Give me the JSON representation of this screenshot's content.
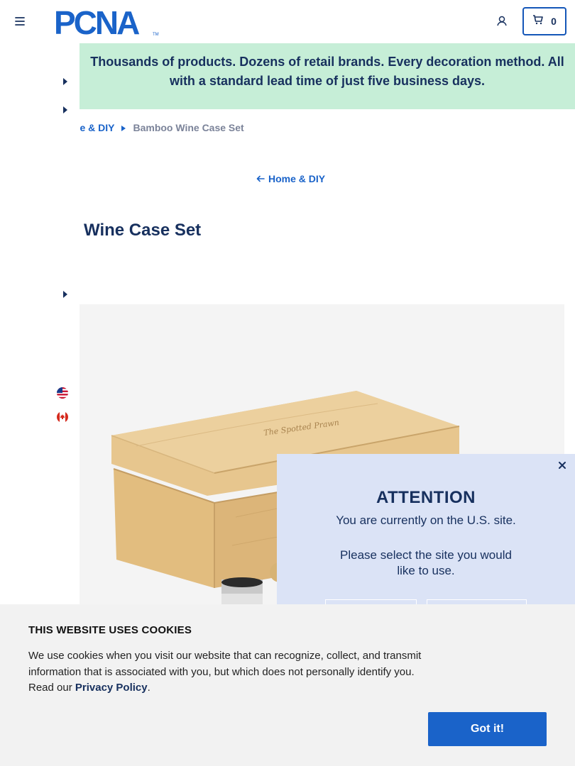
{
  "header": {
    "logo_text": "PCNA",
    "cart_count": "0"
  },
  "banner": {
    "text": "Thousands of products. Dozens of retail brands. Every decoration method. All with a standard lead time of just five business days."
  },
  "breadcrumb": {
    "parent": "me & DIY",
    "current": "Bamboo Wine Case Set"
  },
  "back_link": "Home & DIY",
  "product": {
    "title": "Wine Case Set",
    "brand_engraving": "The Spotted Prawn"
  },
  "modal": {
    "title": "ATTENTION",
    "line1": "You are currently on the U.S. site.",
    "line2": "Please select the site you would like to use."
  },
  "cookie": {
    "title": "THIS WEBSITE USES COOKIES",
    "text_before": "We use cookies when you visit our website that can recognize, collect, and transmit information that is associated with you, but which does not personally identify you. Read our ",
    "link": "Privacy Policy",
    "text_after": ".",
    "button": "Got it!"
  },
  "colors": {
    "primary": "#1a63c9",
    "navy": "#17305e",
    "banner_bg": "#c6eed7",
    "modal_bg": "#dbe3f6",
    "cookie_bg": "#f2f2f2"
  },
  "icons": [
    "menu-icon",
    "user-icon",
    "cart-icon",
    "arrow-left-icon",
    "caret-right-icon",
    "close-icon",
    "us-flag-icon",
    "canada-flag-icon"
  ]
}
